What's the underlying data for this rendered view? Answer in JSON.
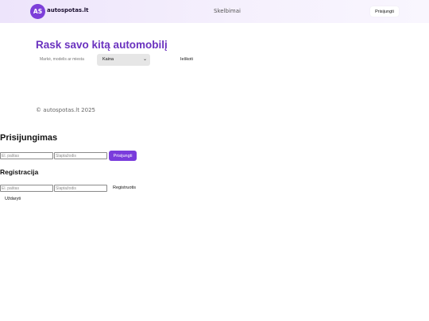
{
  "header": {
    "logo_initials": "AS",
    "logo_text": "autospotas.lt",
    "nav_link": "Skelbimai",
    "login_button": "Prisijungti"
  },
  "hero": {
    "title": "Rask savo kitą automobilį",
    "search_placeholder": "Markė, modelis ar miesta",
    "price_select_value": "Kaina",
    "search_button": "Ieškoti"
  },
  "footer": {
    "copyright": "© autospotas.lt 2025"
  },
  "login": {
    "heading": "Prisijungimas",
    "email_placeholder": "El. paštas",
    "password_placeholder": "Slaptažodis",
    "submit": "Prisijungti"
  },
  "register": {
    "heading": "Registracija",
    "email_placeholder": "El. paštas",
    "password_placeholder": "Slaptažodis",
    "submit": "Registruotis",
    "close": "Uždaryti"
  },
  "colors": {
    "accent": "#7a3cdc",
    "title": "#6a32bf",
    "header_bg": "#ede4fb"
  }
}
